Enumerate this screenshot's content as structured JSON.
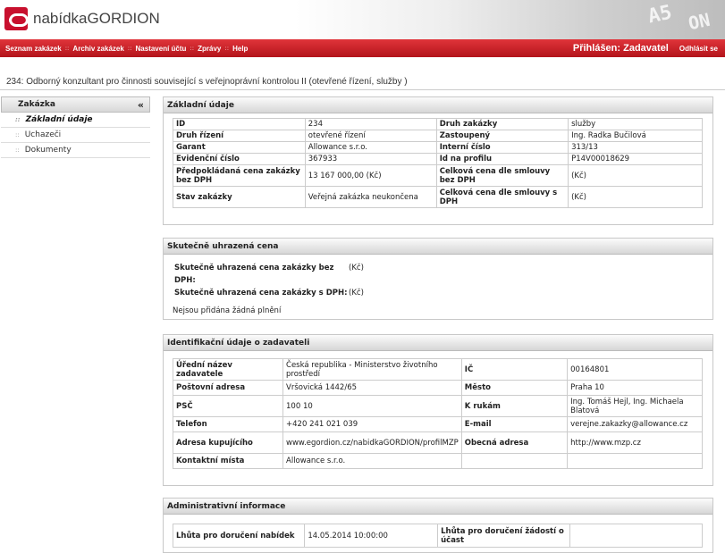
{
  "brand": {
    "logo_text": "nabídkaGORDION"
  },
  "header_deco": [
    "A5",
    "ON"
  ],
  "nav": {
    "items": [
      "Seznam zakázek",
      "Archiv zakázek",
      "Nastavení účtu",
      "Zprávy",
      "Help"
    ],
    "separator": "::",
    "login": "Přihlášen: Zadavatel",
    "logout": "Odhlásit se"
  },
  "page_title": "234: Odborný konzultant pro činnosti související s veřejnoprávní kontrolou II (otevřené řízení, služby )",
  "sidebar": {
    "header": "Zakázka",
    "collapse_icon": "«",
    "bullet": "::",
    "items": [
      "Základní údaje",
      "Uchazeči",
      "Dokumenty"
    ]
  },
  "basic": {
    "title": "Základní údaje",
    "rows": [
      [
        "ID",
        "234",
        "Druh zakázky",
        "služby"
      ],
      [
        "Druh řízení",
        "otevřené řízení",
        "Zastoupený",
        "Ing. Radka Bučilová"
      ],
      [
        "Garant",
        "Allowance s.r.o.",
        "Interní číslo",
        "313/13"
      ],
      [
        "Evidenční číslo",
        "367933",
        "Id na profilu",
        "P14V00018629"
      ],
      [
        "Předpokládaná cena zakázky bez DPH",
        "13 167 000,00 (Kč)",
        "Celková cena dle smlouvy bez DPH",
        "(Kč)"
      ],
      [
        "Stav zakázky",
        "Veřejná zakázka neukončena",
        "Celková cena dle smlouvy s DPH",
        "(Kč)"
      ]
    ]
  },
  "paid": {
    "title": "Skutečně uhrazená cena",
    "rows": [
      {
        "label": "Skutečně uhrazená cena zakázky bez DPH:",
        "value": "(Kč)"
      },
      {
        "label": "Skutečně uhrazená cena zakázky s DPH:",
        "value": "(Kč)"
      }
    ],
    "note": "Nejsou přidána žádná plnění"
  },
  "ident": {
    "title": "Identifikační údaje o zadavateli",
    "rows": [
      [
        "Úřední název zadavatele",
        "Česká republika - Ministerstvo životního prostředí",
        "IČ",
        "00164801"
      ],
      [
        "Poštovní adresa",
        "Vršovická 1442/65",
        "Město",
        "Praha 10"
      ],
      [
        "PSČ",
        "100 10",
        "K rukám",
        "Ing. Tomáš Hejl, Ing. Michaela Blatová"
      ],
      [
        "Telefon",
        "+420 241 021 039",
        "E-mail",
        "verejne.zakazky@allowance.cz"
      ],
      [
        "Adresa kupujícího",
        "www.egordion.cz/nabidkaGORDION/profilMZP",
        "Obecná adresa",
        "http://www.mzp.cz"
      ],
      [
        "Kontaktní místa",
        "Allowance s.r.o.",
        "",
        ""
      ]
    ]
  },
  "admin": {
    "title": "Administrativní informace",
    "rows": [
      [
        "Lhůta pro doručení nabídek",
        "14.05.2014 10:00:00",
        "Lhůta pro doručení žádostí o účast",
        ""
      ]
    ]
  },
  "colors": {
    "nav_red": "#c8102e",
    "panel_header": "#d6d6d6"
  }
}
